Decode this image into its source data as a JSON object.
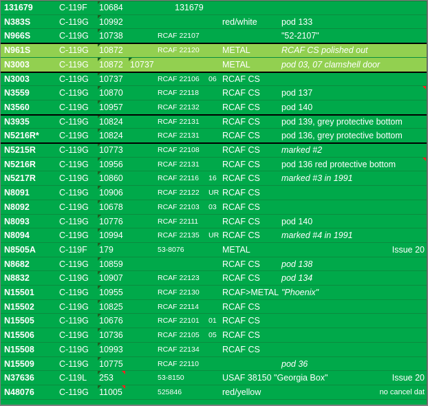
{
  "rows": [
    {
      "reg": "131679",
      "type": "C-119F",
      "msn": "10684",
      "alt": "",
      "rcaf": "131679",
      "flt": "",
      "paint": "",
      "note": "",
      "style": "dark",
      "rcaf_big": true
    },
    {
      "reg": "N383S",
      "type": "C-119G",
      "msn": "10992",
      "alt": "",
      "rcaf": "",
      "flt": "",
      "paint": "red/white",
      "note": "pod 133",
      "style": "dark"
    },
    {
      "reg": "N966S",
      "type": "C-119G",
      "msn": "10738",
      "alt": "",
      "rcaf": "RCAF 22107",
      "flt": "",
      "paint": "",
      "note": "\"52-2107\"",
      "style": "dark"
    },
    {
      "reg": "N961S",
      "type": "C-119G",
      "msn": "10872",
      "alt": "",
      "rcaf": "RCAF 22120",
      "flt": "",
      "paint": "METAL",
      "note": "RCAF CS polished out",
      "note_italic": true,
      "style": "light"
    },
    {
      "reg": "N3003",
      "type": "C-119G",
      "msn": "10872",
      "alt": "10737",
      "rcaf": "",
      "flt": "",
      "paint": "METAL",
      "note": "pod 03, 07 clamshell door",
      "note_italic": true,
      "style": "light"
    },
    {
      "reg": "N3003",
      "type": "C-119G",
      "msn": "10737",
      "alt": "",
      "rcaf": "RCAF 22106",
      "flt": "06",
      "paint": "RCAF CS",
      "note": "",
      "style": "dark"
    },
    {
      "reg": "N3559",
      "type": "C-119G",
      "msn": "10870",
      "alt": "",
      "rcaf": "RCAF 22118",
      "flt": "",
      "paint": "RCAF CS",
      "note": "pod 137",
      "style": "dark",
      "red_tri": true
    },
    {
      "reg": "N3560",
      "type": "C-119G",
      "msn": "10957",
      "alt": "",
      "rcaf": "RCAF 22132",
      "flt": "",
      "paint": "RCAF CS",
      "note": "pod 140",
      "style": "dark"
    },
    {
      "reg": "N3935",
      "type": "C-119G",
      "msn": "10824",
      "alt": "",
      "rcaf": "RCAF 22131",
      "flt": "",
      "paint": "RCAF CS",
      "note": "pod 139, grey protective bottom",
      "style": "dark"
    },
    {
      "reg": "N5216R*",
      "type": "C-119G",
      "msn": "10824",
      "alt": "",
      "rcaf": "RCAF 22131",
      "flt": "",
      "paint": "RCAF CS",
      "note": "pod 136, grey protective bottom",
      "style": "dark"
    },
    {
      "reg": "N5215R",
      "type": "C-119G",
      "msn": "10773",
      "alt": "",
      "rcaf": "RCAF 22108",
      "flt": "",
      "paint": "RCAF CS",
      "note": "marked #2",
      "note_italic": true,
      "style": "dark"
    },
    {
      "reg": "N5216R",
      "type": "C-119G",
      "msn": "10956",
      "alt": "",
      "rcaf": "RCAF 22131",
      "flt": "",
      "paint": "RCAF CS",
      "note": "pod 136 red protective bottom",
      "style": "dark",
      "red_tri": true
    },
    {
      "reg": "N5217R",
      "type": "C-119G",
      "msn": "10860",
      "alt": "",
      "rcaf": "RCAF 22116",
      "flt": "16",
      "paint": "RCAF CS",
      "note": "marked #3 in 1991",
      "note_italic": true,
      "style": "dark"
    },
    {
      "reg": "N8091",
      "type": "C-119G",
      "msn": "10906",
      "alt": "",
      "rcaf": "RCAF 22122",
      "flt": "UR",
      "paint": "RCAF CS",
      "note": "",
      "style": "dark"
    },
    {
      "reg": "N8092",
      "type": "C-119G",
      "msn": "10678",
      "alt": "",
      "rcaf": "RCAF 22103",
      "flt": "03",
      "paint": "RCAF CS",
      "note": "",
      "style": "dark"
    },
    {
      "reg": "N8093",
      "type": "C-119G",
      "msn": "10776",
      "alt": "",
      "rcaf": "RCAF 22111",
      "flt": "",
      "paint": "RCAF CS",
      "note": "pod 140",
      "style": "dark"
    },
    {
      "reg": "N8094",
      "type": "C-119G",
      "msn": "10994",
      "alt": "",
      "rcaf": "RCAF 22135",
      "flt": "UR",
      "paint": "RCAF CS",
      "note": "marked #4 in 1991",
      "note_italic": true,
      "style": "dark"
    },
    {
      "reg": "N8505A",
      "type": "C-119F",
      "msn": "179",
      "alt": "",
      "rcaf": "53-8076",
      "flt": "",
      "paint": "METAL",
      "note": "",
      "issue": "Issue 20",
      "style": "dark"
    },
    {
      "reg": "N8682",
      "type": "C-119G",
      "msn": "10859",
      "alt": "",
      "rcaf": "",
      "flt": "",
      "paint": "RCAF CS",
      "note": "pod 138",
      "note_italic": true,
      "style": "dark"
    },
    {
      "reg": "N8832",
      "type": "C-119G",
      "msn": "10907",
      "alt": "",
      "rcaf": "RCAF 22123",
      "flt": "",
      "paint": "RCAF CS",
      "note": "pod 134",
      "note_italic": true,
      "style": "dark"
    },
    {
      "reg": "N15501",
      "type": "C-119G",
      "msn": "10955",
      "alt": "",
      "rcaf": "RCAF 22130",
      "flt": "",
      "paint": "RCAF>METAL",
      "note": "\"Phoenix\"",
      "note_italic": true,
      "style": "dark"
    },
    {
      "reg": "N15502",
      "type": "C-119G",
      "msn": "10825",
      "alt": "",
      "rcaf": "RCAF 22114",
      "flt": "",
      "paint": "RCAF CS",
      "note": "",
      "style": "dark"
    },
    {
      "reg": "N15505",
      "type": "C-119G",
      "msn": "10676",
      "alt": "",
      "rcaf": "RCAF 22101",
      "flt": "01",
      "paint": "RCAF CS",
      "note": "",
      "style": "dark"
    },
    {
      "reg": "N15506",
      "type": "C-119G",
      "msn": "10736",
      "alt": "",
      "rcaf": "RCAF 22105",
      "flt": "05",
      "paint": "RCAF CS",
      "note": "",
      "style": "dark"
    },
    {
      "reg": "N15508",
      "type": "C-119G",
      "msn": "10993",
      "alt": "",
      "rcaf": "RCAF 22134",
      "flt": "",
      "paint": "RCAF CS",
      "note": "",
      "style": "dark"
    },
    {
      "reg": "N15509",
      "type": "C-119G",
      "msn": "10775",
      "alt": "",
      "rcaf": "RCAF 22110",
      "flt": "",
      "paint": "",
      "note": "pod 36",
      "note_italic": true,
      "style": "dark"
    },
    {
      "reg": "N37636",
      "type": "C-119L",
      "msn": "253",
      "alt": "",
      "rcaf": "53-8150",
      "flt": "",
      "paint": "USAF 38150 \"Georgia Box\"",
      "note": "",
      "issue": "Issue 20",
      "style": "dark",
      "msn_red": true
    },
    {
      "reg": "N48076",
      "type": "C-119G",
      "msn": "11005",
      "alt": "",
      "rcaf": "525846",
      "flt": "",
      "paint": "red/yellow",
      "note": "",
      "cancel": "no cancel dat",
      "style": "dark",
      "msn_red": true
    }
  ],
  "colors": {
    "sheet_green": "#00a94a",
    "highlight_green": "#92d050",
    "text": "#ffffff",
    "divider": "#000000"
  }
}
